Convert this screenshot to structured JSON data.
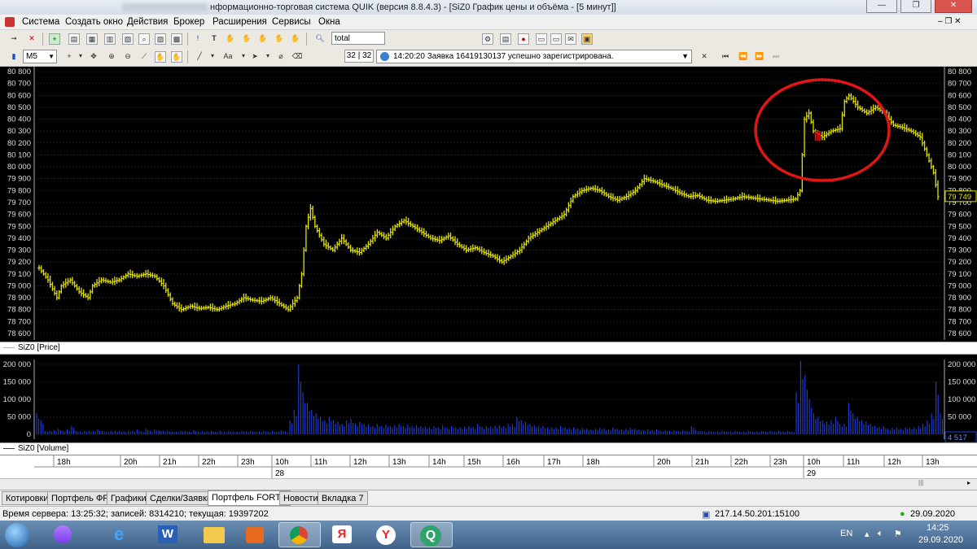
{
  "window": {
    "title": "нформационно-торговая система QUIK (версия 8.8.4.3) - [SiZ0 График цены и объёма - [5 минут]]"
  },
  "menu": [
    "Система",
    "Создать окно",
    "Действия",
    "Брокер",
    "Расширения",
    "Сервисы",
    "Окна"
  ],
  "toolbar": {
    "search_value": "total",
    "timeframe": "M5",
    "font_button": "Aa",
    "counter": "32 | 32",
    "message": "14:20:20  Заявка 16419130137 успешно зарегистрирована."
  },
  "chart": {
    "price_series_label": "SiZ0 [Price]",
    "volume_series_label": "SiZ0 [Volume]",
    "current_price_label": "79 749",
    "current_volume_label": "4 517",
    "price_ticks": [
      "80 800",
      "80 700",
      "80 600",
      "80 500",
      "80 400",
      "80 300",
      "80 200",
      "80 100",
      "80 000",
      "79 900",
      "79 800",
      "79 700",
      "79 600",
      "79 500",
      "79 400",
      "79 300",
      "79 200",
      "79 100",
      "79 000",
      "78 900",
      "78 800",
      "78 700",
      "78 600"
    ],
    "volume_ticks": [
      "200 000",
      "150 000",
      "100 000",
      "50 000",
      "0"
    ],
    "time_labels": [
      "18h",
      "20h",
      "21h",
      "22h",
      "23h",
      "10h",
      "11h",
      "12h",
      "13h",
      "14h",
      "15h",
      "16h",
      "17h",
      "18h",
      "20h",
      "21h",
      "22h",
      "23h",
      "10h",
      "11h",
      "12h",
      "13h"
    ],
    "day_labels": [
      "28",
      "29"
    ],
    "colors": {
      "background": "#000000",
      "price": "#e3e300",
      "volume": "#1f3fe0",
      "highlight": "#e01010",
      "annotation": "#e01515"
    }
  },
  "chart_data": {
    "type": "line",
    "title": "",
    "ylim": [
      78600,
      80800
    ],
    "price_path": [
      [
        0,
        79150
      ],
      [
        2,
        79050
      ],
      [
        4,
        78900
      ],
      [
        5,
        79000
      ],
      [
        7,
        79050
      ],
      [
        9,
        78950
      ],
      [
        11,
        78900
      ],
      [
        12,
        79000
      ],
      [
        14,
        79050
      ],
      [
        16,
        79030
      ],
      [
        18,
        79050
      ],
      [
        20,
        79100
      ],
      [
        22,
        79080
      ],
      [
        24,
        79100
      ],
      [
        26,
        79080
      ],
      [
        28,
        79000
      ],
      [
        30,
        78850
      ],
      [
        32,
        78800
      ],
      [
        34,
        78830
      ],
      [
        36,
        78810
      ],
      [
        38,
        78820
      ],
      [
        40,
        78800
      ],
      [
        42,
        78830
      ],
      [
        44,
        78850
      ],
      [
        46,
        78900
      ],
      [
        48,
        78880
      ],
      [
        50,
        78870
      ],
      [
        52,
        78900
      ],
      [
        54,
        78850
      ],
      [
        56,
        78800
      ],
      [
        58,
        78900
      ],
      [
        59,
        79100
      ],
      [
        60,
        79500
      ],
      [
        61,
        79650
      ],
      [
        62,
        79500
      ],
      [
        64,
        79350
      ],
      [
        66,
        79300
      ],
      [
        68,
        79400
      ],
      [
        70,
        79300
      ],
      [
        72,
        79280
      ],
      [
        74,
        79350
      ],
      [
        76,
        79450
      ],
      [
        78,
        79400
      ],
      [
        80,
        79500
      ],
      [
        82,
        79550
      ],
      [
        84,
        79500
      ],
      [
        86,
        79450
      ],
      [
        88,
        79400
      ],
      [
        90,
        79380
      ],
      [
        92,
        79420
      ],
      [
        94,
        79350
      ],
      [
        96,
        79300
      ],
      [
        98,
        79320
      ],
      [
        100,
        79280
      ],
      [
        102,
        79250
      ],
      [
        104,
        79200
      ],
      [
        106,
        79250
      ],
      [
        108,
        79300
      ],
      [
        110,
        79400
      ],
      [
        112,
        79450
      ],
      [
        114,
        79500
      ],
      [
        116,
        79550
      ],
      [
        118,
        79600
      ],
      [
        120,
        79750
      ],
      [
        122,
        79800
      ],
      [
        124,
        79820
      ],
      [
        126,
        79800
      ],
      [
        128,
        79750
      ],
      [
        130,
        79720
      ],
      [
        132,
        79750
      ],
      [
        134,
        79800
      ],
      [
        136,
        79900
      ],
      [
        138,
        79880
      ],
      [
        140,
        79850
      ],
      [
        142,
        79820
      ],
      [
        144,
        79780
      ],
      [
        146,
        79750
      ],
      [
        148,
        79760
      ],
      [
        150,
        79720
      ],
      [
        152,
        79710
      ],
      [
        154,
        79720
      ],
      [
        156,
        79730
      ],
      [
        158,
        79750
      ],
      [
        160,
        79740
      ],
      [
        162,
        79730
      ],
      [
        164,
        79720
      ],
      [
        166,
        79710
      ],
      [
        168,
        79720
      ],
      [
        170,
        79730
      ],
      [
        171,
        79800
      ],
      [
        172,
        80400
      ],
      [
        173,
        80450
      ],
      [
        174,
        80300
      ],
      [
        176,
        80250
      ],
      [
        178,
        80300
      ],
      [
        180,
        80320
      ],
      [
        181,
        80550
      ],
      [
        182,
        80600
      ],
      [
        184,
        80500
      ],
      [
        186,
        80450
      ],
      [
        188,
        80500
      ],
      [
        190,
        80450
      ],
      [
        192,
        80350
      ],
      [
        194,
        80330
      ],
      [
        196,
        80300
      ],
      [
        198,
        80250
      ],
      [
        200,
        80050
      ],
      [
        201,
        79950
      ],
      [
        202,
        79749
      ]
    ],
    "volume_heights": [
      0.3,
      0.2,
      0.05,
      0.05,
      0.06,
      0.08,
      0.05,
      0.07,
      0.12,
      0.05,
      0.04,
      0.05,
      0.05,
      0.05,
      0.07,
      0.05,
      0.04,
      0.05,
      0.05,
      0.05,
      0.04,
      0.05,
      0.05,
      0.07,
      0.04,
      0.08,
      0.05,
      0.07,
      0.06,
      0.05,
      0.05,
      0.04,
      0.04,
      0.05,
      0.05,
      0.04,
      0.06,
      0.04,
      0.05,
      0.04,
      0.05,
      0.04,
      0.05,
      0.04,
      0.05,
      0.04,
      0.04,
      0.05,
      0.04,
      0.05,
      0.04,
      0.04,
      0.05,
      0.04,
      0.05,
      0.04,
      0.06,
      0.04,
      0.2,
      0.35,
      1.0,
      0.6,
      0.45,
      0.35,
      0.3,
      0.25,
      0.2,
      0.25,
      0.2,
      0.18,
      0.15,
      0.2,
      0.22,
      0.15,
      0.18,
      0.15,
      0.14,
      0.12,
      0.15,
      0.12,
      0.14,
      0.12,
      0.13,
      0.15,
      0.12,
      0.14,
      0.12,
      0.13,
      0.12,
      0.11,
      0.1,
      0.12,
      0.1,
      0.13,
      0.1,
      0.12,
      0.1,
      0.1,
      0.11,
      0.12,
      0.1,
      0.15,
      0.1,
      0.12,
      0.11,
      0.12,
      0.13,
      0.12,
      0.15,
      0.14,
      0.25,
      0.2,
      0.18,
      0.15,
      0.13,
      0.12,
      0.12,
      0.1,
      0.1,
      0.1,
      0.12,
      0.1,
      0.09,
      0.1,
      0.08,
      0.09,
      0.08,
      0.07,
      0.08,
      0.09,
      0.08,
      0.07,
      0.1,
      0.08,
      0.07,
      0.08,
      0.09,
      0.08,
      0.07,
      0.06,
      0.07,
      0.06,
      0.07,
      0.05,
      0.06,
      0.05,
      0.06,
      0.05,
      0.06,
      0.05,
      0.12,
      0.06,
      0.05,
      0.04,
      0.05,
      0.04,
      0.04,
      0.05,
      0.04,
      0.04,
      0.05,
      0.04,
      0.04,
      0.05,
      0.04,
      0.04,
      0.05,
      0.04,
      0.05,
      0.04,
      0.05,
      0.04,
      0.05,
      0.04,
      0.6,
      1.05,
      0.85,
      0.5,
      0.3,
      0.25,
      0.2,
      0.18,
      0.2,
      0.25,
      0.15,
      0.15,
      0.45,
      0.3,
      0.25,
      0.2,
      0.18,
      0.15,
      0.12,
      0.1,
      0.12,
      0.08,
      0.09,
      0.1,
      0.08,
      0.1,
      0.09,
      0.1,
      0.12,
      0.15,
      0.2,
      0.3,
      0.75,
      0.3
    ]
  },
  "tabs": [
    "Котировки",
    "Портфель ФР",
    "Графики",
    "Сделки/Заявки",
    "Портфель FORTS",
    "Новости",
    "Вкладка 7"
  ],
  "status": {
    "server_time": "Время сервера: 13:25:32; записей: 8314210; текущая: 19397202",
    "connection": "217.14.50.201:15100",
    "date": "29.09.2020"
  },
  "taskbar": {
    "lang": "EN",
    "time": "14:25",
    "date": "29.09.2020"
  }
}
